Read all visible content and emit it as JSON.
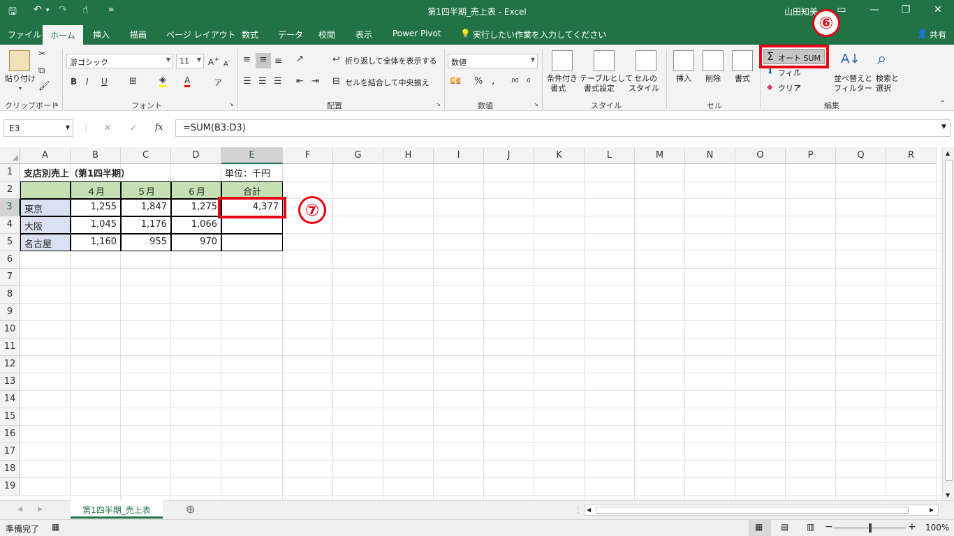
{
  "window": {
    "title": "第1四半期_売上表  -  Excel",
    "user": "山田知美"
  },
  "tabs": [
    "ファイル",
    "ホーム",
    "挿入",
    "描画",
    "ページ レイアウト",
    "数式",
    "データ",
    "校閲",
    "表示",
    "Power Pivot"
  ],
  "tell_me": "実行したい作業を入力してください",
  "share": "共有",
  "ribbon": {
    "clipboard": {
      "label": "クリップボード",
      "paste": "貼り付け"
    },
    "font": {
      "label": "フォント",
      "name": "游ゴシック",
      "size": "11"
    },
    "alignment": {
      "label": "配置",
      "wrap": "折り返して全体を表示する",
      "merge": "セルを結合して中央揃え"
    },
    "number": {
      "label": "数値",
      "format": "数値"
    },
    "styles": {
      "label": "スタイル",
      "cond1": "条件付き",
      "cond2": "書式",
      "table1": "テーブルとして",
      "table2": "書式設定",
      "cell1": "セルの",
      "cell2": "スタイル"
    },
    "cells": {
      "label": "セル",
      "insert": "挿入",
      "delete": "削除",
      "format": "書式"
    },
    "editing": {
      "label": "編集",
      "autosum": "オート SUM",
      "fill": "フィル",
      "clear": "クリア",
      "sort1": "並べ替えと",
      "sort2": "フィルター",
      "find1": "検索と",
      "find2": "選択"
    }
  },
  "formula_bar": {
    "name_box": "E3",
    "formula": "=SUM(B3:D3)"
  },
  "columns": [
    "A",
    "B",
    "C",
    "D",
    "E",
    "F",
    "G",
    "H",
    "I",
    "J",
    "K",
    "L",
    "M",
    "N",
    "O",
    "P",
    "Q",
    "R"
  ],
  "rows": [
    "1",
    "2",
    "3",
    "4",
    "5",
    "6",
    "7",
    "8",
    "9",
    "10",
    "11",
    "12",
    "13",
    "14",
    "15",
    "16",
    "17",
    "18",
    "19"
  ],
  "cells": {
    "A1": "支店別売上（第1四半期）",
    "E1": "単位：千円",
    "B2": "４月",
    "C2": "５月",
    "D2": "６月",
    "E2": "合計",
    "A3": "東京",
    "B3": "1,255",
    "C3": "1,847",
    "D3": "1,275",
    "E3": "4,377",
    "A4": "大阪",
    "B4": "1,045",
    "C4": "1,176",
    "D4": "1,066",
    "A5": "名古屋",
    "B5": "1,160",
    "C5": "955",
    "D5": "970"
  },
  "sheet_tab": "第1四半期_売上表",
  "status": {
    "ready": "準備完了",
    "zoom": "100%"
  },
  "callouts": {
    "six": "⑥",
    "seven": "⑦"
  },
  "colors": {
    "excel_green": "#217346",
    "header_green": "#c6e0b4",
    "branch_blue": "#d9e1f2",
    "highlight_red": "#e60012"
  }
}
